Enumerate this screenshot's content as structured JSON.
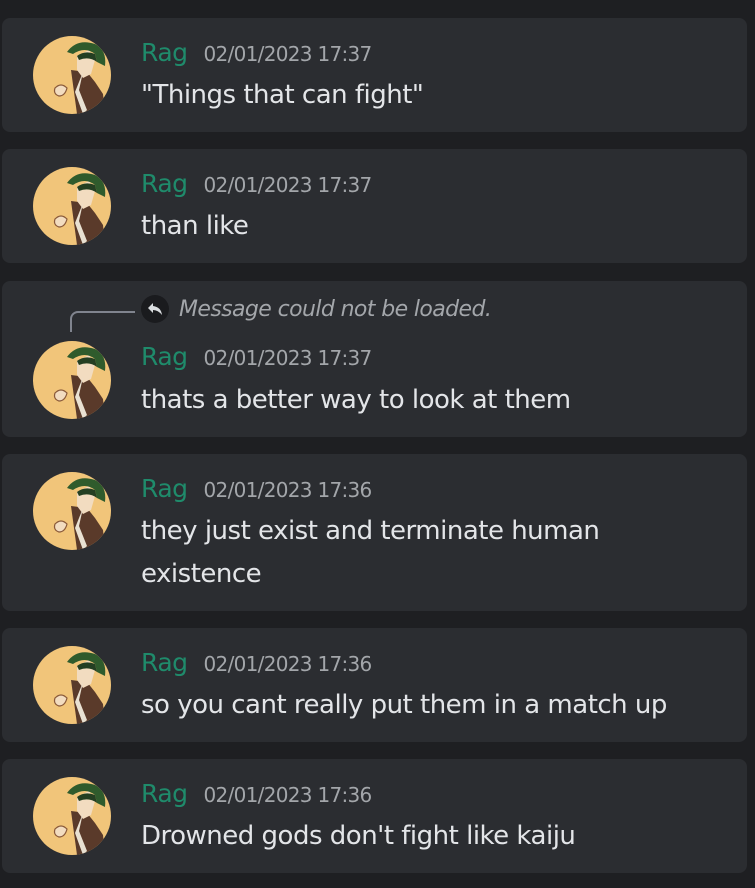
{
  "reply_preview": {
    "icon": "reply-arrow-icon",
    "text": "Message could not be loaded."
  },
  "messages": [
    {
      "author": "Rag",
      "timestamp": "02/01/2023 17:37",
      "lines": [
        "\"Things that can fight\""
      ]
    },
    {
      "author": "Rag",
      "timestamp": "02/01/2023 17:37",
      "lines": [
        "than like"
      ]
    },
    {
      "author": "Rag",
      "timestamp": "02/01/2023 17:37",
      "lines": [
        "thats a better way to look at them"
      ]
    },
    {
      "author": "Rag",
      "timestamp": "02/01/2023 17:36",
      "lines": [
        "they just exist and terminate human",
        "existence"
      ]
    },
    {
      "author": "Rag",
      "timestamp": "02/01/2023 17:36",
      "lines": [
        "so you cant really put them in a match up"
      ]
    },
    {
      "author": "Rag",
      "timestamp": "02/01/2023 17:36",
      "lines": [
        "Drowned gods don't fight like kaiju"
      ]
    }
  ],
  "colors": {
    "page_background": "#1e1f22",
    "card_background": "#2b2d31",
    "author": "#1f8b6b",
    "timestamp": "#a3a6aa",
    "message_text": "#e3e5e8",
    "avatar_background": "#f1c57a"
  }
}
